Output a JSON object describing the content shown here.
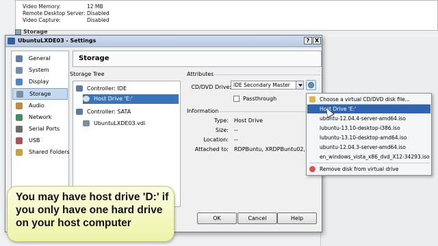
{
  "background": {
    "rows": [
      {
        "label": "Video Memory:",
        "value": "12 MB"
      },
      {
        "label": "Remote Desktop Server:",
        "value": "Disabled"
      },
      {
        "label": "Video Capture:",
        "value": "Disabled"
      }
    ],
    "section": "Storage"
  },
  "dialog": {
    "title": "UbuntuLXDE03 - Settings",
    "help_btn": "?",
    "close_btn": "X",
    "header": "Storage",
    "nav": [
      "General",
      "System",
      "Display",
      "Storage",
      "Audio",
      "Network",
      "Serial Ports",
      "USB",
      "Shared Folders"
    ],
    "nav_icon_colors": [
      "#5b7fa8",
      "#6f8fb0",
      "#4b86c8",
      "#7a8e9e",
      "#c28a3a",
      "#3f8f5a",
      "#6c6c6c",
      "#b05252",
      "#c9a13a"
    ],
    "storage_tree_label": "Storage Tree",
    "tree": {
      "ide": "Controller: IDE",
      "host_drive": "Host Drive 'E:'",
      "sata": "Controller: SATA",
      "vdi": "UbuntuLXDE03.vdi"
    },
    "attributes_label": "Attributes",
    "cd_label": "CD/DVD Drive:",
    "cd_value": "IDE Secondary Master",
    "passthrough": "Passthrough",
    "information_label": "Information",
    "info": [
      {
        "label": "Type:",
        "value": "Host Drive"
      },
      {
        "label": "Size:",
        "value": "--"
      },
      {
        "label": "Location:",
        "value": "--"
      },
      {
        "label": "Attached to:",
        "value": "RDPBuntu, XRDPBuntu02, DBA"
      }
    ],
    "buttons": {
      "ok": "OK",
      "cancel": "Cancel",
      "help": "Help"
    }
  },
  "menu": {
    "choose": "Choose a virtual CD/DVD disk file...",
    "items": [
      "Host Drive 'E:'",
      "ubuntu-12.04.4-server-amd64.iso",
      "lubuntu-13.10-desktop-i386.iso",
      "lubuntu-13.10-desktop-amd64.iso",
      "ubuntu-12.04.3-server-amd64.iso",
      "en_windows_vista_x86_dvd_X12-34293.iso"
    ],
    "remove": "Remove disk from virtual drive"
  },
  "callout": "You may have host drive 'D:' if you only have one hard drive on your host computer"
}
